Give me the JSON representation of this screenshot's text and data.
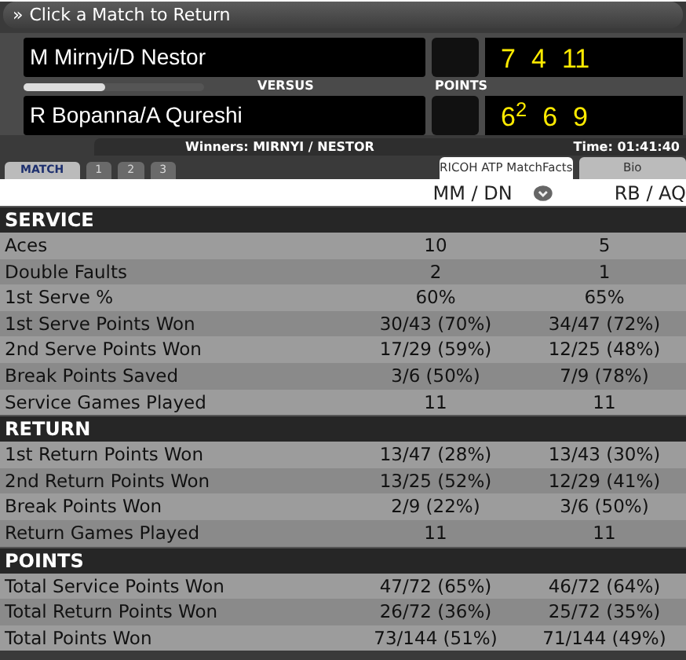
{
  "top_bar": {
    "glyph": "»",
    "label": "Click a Match to Return"
  },
  "teams": [
    {
      "name": "M Mirnyi/D Nestor",
      "sets": [
        "7",
        "4",
        "11"
      ]
    },
    {
      "name": "R Bopanna/A Qureshi",
      "sets": [
        "6$^{2}$",
        "6",
        "9"
      ]
    }
  ],
  "versus_label": "VERSUS",
  "points_label": "POINTS",
  "momentum": {
    "level": 0.45
  },
  "winners": "Winners: MIRNYI / NESTOR",
  "time": "Time:  01:41:40",
  "set_tabs": [
    {
      "label": "MATCH",
      "selected": true
    },
    {
      "label": "1",
      "selected": false
    },
    {
      "label": "2",
      "selected": false
    },
    {
      "label": "3",
      "selected": false
    }
  ],
  "view_tabs": [
    {
      "label": "RICOH ATP MatchFacts",
      "selected": true
    },
    {
      "label": "Bio",
      "selected": false
    }
  ],
  "columns": [
    "MM / DN",
    "RB / AQ"
  ],
  "sections": [
    {
      "title": "SERVICE",
      "rows": [
        {
          "label": "Aces",
          "values": [
            "10",
            "5"
          ]
        },
        {
          "label": "Double Faults",
          "values": [
            "2",
            "1"
          ]
        },
        {
          "label": "1st Serve %",
          "values": [
            "60%",
            "65%"
          ]
        },
        {
          "label": "1st Serve Points Won",
          "values": [
            "30/43 (70%)",
            "34/47 (72%)"
          ]
        },
        {
          "label": "2nd Serve Points Won",
          "values": [
            "17/29 (59%)",
            "12/25 (48%)"
          ]
        },
        {
          "label": "Break Points Saved",
          "values": [
            "3/6 (50%)",
            "7/9 (78%)"
          ]
        },
        {
          "label": "Service Games Played",
          "values": [
            "11",
            "11"
          ]
        }
      ]
    },
    {
      "title": "RETURN",
      "rows": [
        {
          "label": "1st Return Points Won",
          "values": [
            "13/47 (28%)",
            "13/43 (30%)"
          ]
        },
        {
          "label": "2nd Return Points Won",
          "values": [
            "13/25 (52%)",
            "12/29 (41%)"
          ]
        },
        {
          "label": "Break Points Won",
          "values": [
            "2/9 (22%)",
            "3/6 (50%)"
          ]
        },
        {
          "label": "Return Games Played",
          "values": [
            "11",
            "11"
          ]
        }
      ]
    },
    {
      "title": "POINTS",
      "rows": [
        {
          "label": "Total Service Points Won",
          "values": [
            "47/72 (65%)",
            "46/72 (64%)"
          ]
        },
        {
          "label": "Total Return Points Won",
          "values": [
            "26/72 (36%)",
            "25/72 (35%)"
          ]
        },
        {
          "label": "Total Points Won",
          "values": [
            "73/144 (51%)",
            "71/144 (49%)"
          ]
        }
      ]
    }
  ]
}
